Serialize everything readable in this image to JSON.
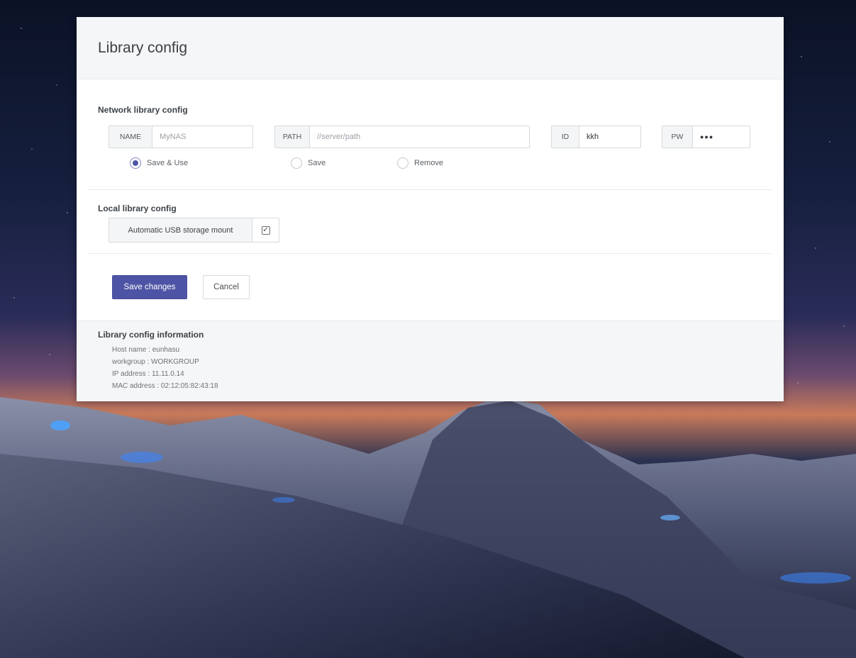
{
  "panel": {
    "title": "Library config"
  },
  "network": {
    "section_label": "Network library config",
    "name_label": "NAME",
    "name_placeholder": "MyNAS",
    "path_label": "PATH",
    "path_placeholder": "//server/path",
    "id_label": "ID",
    "id_value": "kkh",
    "pw_label": "PW",
    "pw_value": "●●●",
    "options": [
      {
        "label": "Save & Use",
        "selected": true
      },
      {
        "label": "Save",
        "selected": false
      },
      {
        "label": "Remove",
        "selected": false
      }
    ]
  },
  "local": {
    "section_label": "Local library config",
    "usb_label": "Automatic USB storage mount",
    "usb_checked": true,
    "check_glyph": "✓"
  },
  "actions": {
    "save_label": "Save changes",
    "cancel_label": "Cancel"
  },
  "info": {
    "title": "Library config information",
    "lines": [
      "Host name : eunhasu",
      "workgroup : WORKGROUP",
      "IP address : 11.11.0.14",
      "MAC address : 02:12:05:82:43:18"
    ]
  },
  "colors": {
    "primary": "#4e54a5",
    "panel_bg": "#ffffff",
    "header_bg": "#f4f6f7"
  }
}
